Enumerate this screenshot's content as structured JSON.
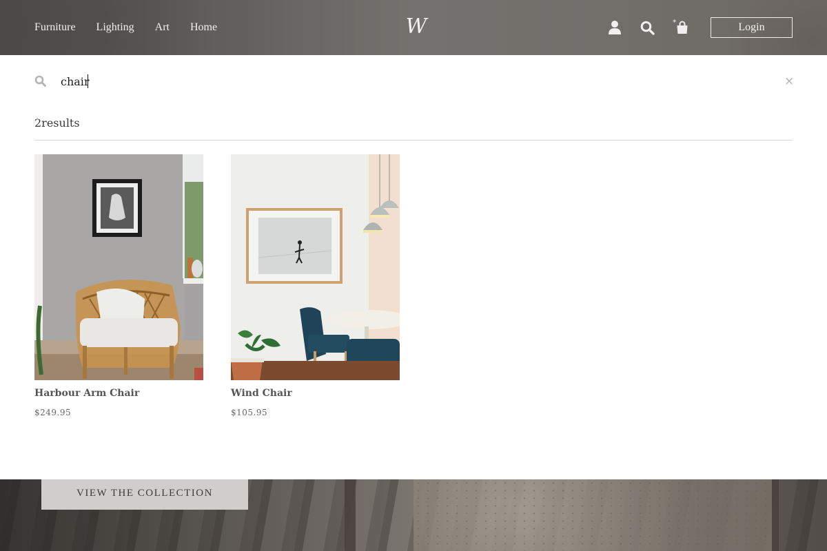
{
  "header": {
    "nav": [
      {
        "label": "Furniture"
      },
      {
        "label": "Lighting"
      },
      {
        "label": "Art"
      },
      {
        "label": "Home"
      }
    ],
    "logo_text": "W",
    "icons": [
      "user-icon",
      "search-icon",
      "shopping-bag-icon"
    ],
    "cart_indicator": "*",
    "login_label": "Login"
  },
  "search": {
    "query": "chair",
    "icon": "search-icon",
    "close_label": "×",
    "results_count_text": "2results"
  },
  "results": [
    {
      "name": "Harbour Arm Chair",
      "price": "$249.95"
    },
    {
      "name": "Wind Chair",
      "price": "$105.95"
    }
  ],
  "hero": {
    "cta_label": "VIEW THE COLLECTION"
  },
  "colors": {
    "header_text": "#f2f0ee",
    "panel_bg": "#ffffff",
    "product_name": "#555555",
    "cta_bg": "#d0cdca"
  }
}
